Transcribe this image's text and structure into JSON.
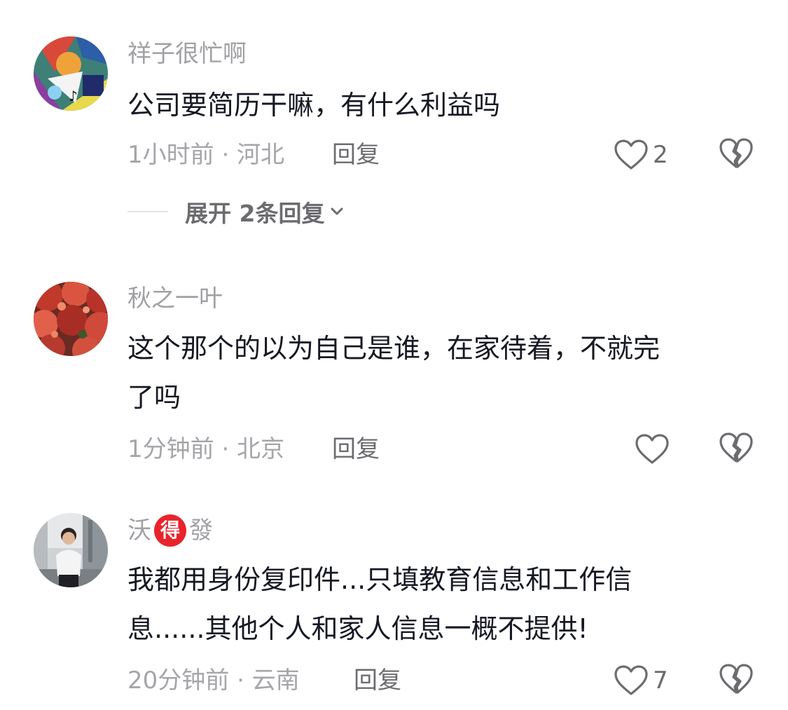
{
  "comments": [
    {
      "username": "祥子很忙啊",
      "text": "公司要简历干嘛，有什么利益吗",
      "time": "1小时前",
      "location": "河北",
      "meta": "1小时前 · 河北",
      "reply_label": "回复",
      "likes": "2",
      "expand_label": "展开 2条回复"
    },
    {
      "username": "秋之一叶",
      "text_line1": "这个那个的以为自己是谁，在家待着，不就完",
      "text_line2": "了吗",
      "meta": "1分钟前 · 北京",
      "reply_label": "回复",
      "likes": ""
    },
    {
      "username_part1": "沃",
      "badge": "得",
      "username_part2": "發",
      "text_line1": "我都用身份复印件...只填教育信息和工作信",
      "text_line2": "息......其他个人和家人信息一概不提供!",
      "meta": "20分钟前 · 云南",
      "reply_label": "回复",
      "likes": "7"
    }
  ],
  "colors": {
    "text": "#161823",
    "muted": "#a0a0a5",
    "action": "#6b6b70",
    "badge": "#e8242b"
  },
  "icons": [
    "heart-icon",
    "broken-heart-icon",
    "chevron-down-icon"
  ]
}
